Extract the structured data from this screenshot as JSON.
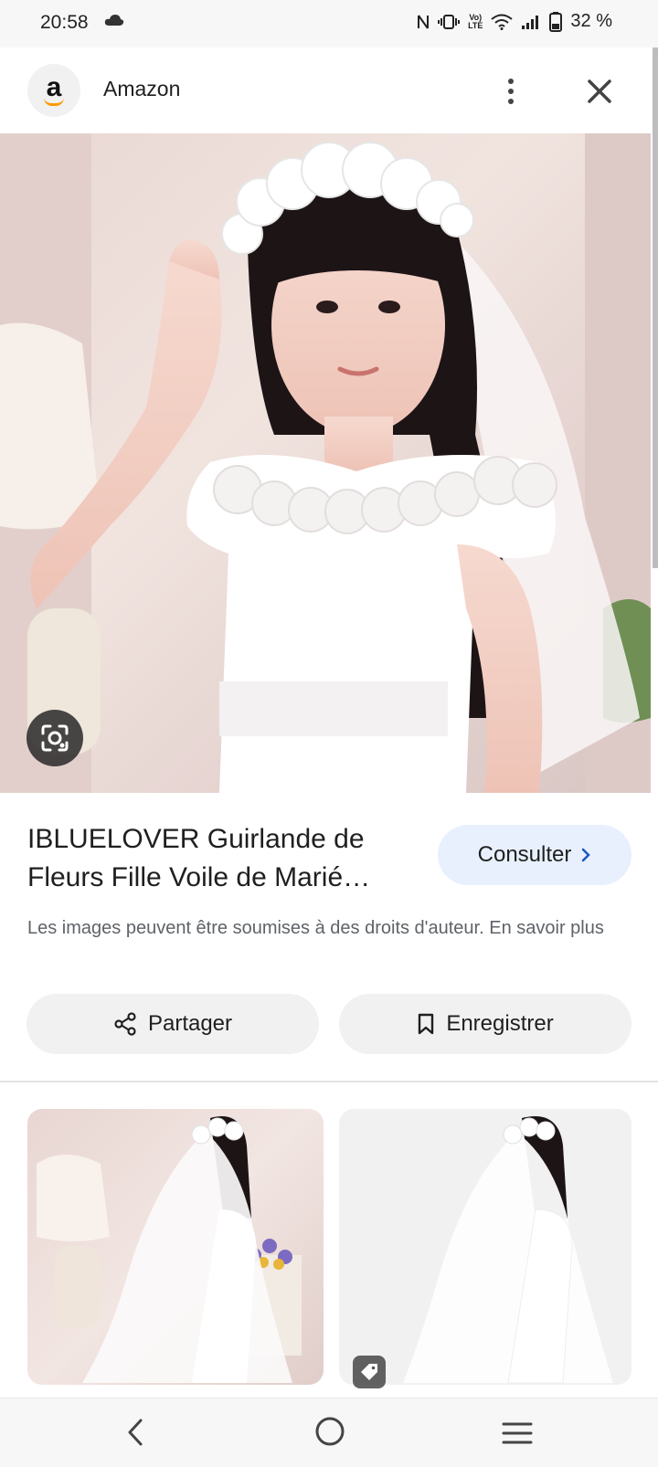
{
  "status_bar": {
    "time": "20:58",
    "battery": "32 %",
    "icons": [
      "cloud-icon",
      "nfc-icon",
      "vibrate-icon",
      "volte-icon",
      "wifi-icon",
      "signal-icon",
      "battery-icon"
    ],
    "volte_line1": "Vo)",
    "volte_line2": "LTE"
  },
  "header": {
    "site_name": "Amazon",
    "logo_letter": "a",
    "logo_colors": {
      "letter": "#111111",
      "smile": "#FF9900"
    }
  },
  "main": {
    "image_alt": "Fillette en robe blanche portant une guirlande de fleurs et un voile",
    "title": "IBLUELOVER Guirlande de Fleurs Fille Voile de Marié…",
    "visit_label": "Consulter",
    "copyright_text": "Les images peuvent être soumises à des droits d'auteur.",
    "learn_more": "En savoir plus",
    "share_label": "Partager",
    "save_label": "Enregistrer"
  },
  "related": {
    "items": [
      {
        "alt": "Voile de communion avec couronne de fleurs, vue de dos"
      },
      {
        "alt": "Voile de communion avec couronne de fleurs sur fond gris"
      }
    ]
  },
  "colors": {
    "accent_button_bg": "#e8f0fe",
    "chip_bg": "#f1f1f1"
  }
}
